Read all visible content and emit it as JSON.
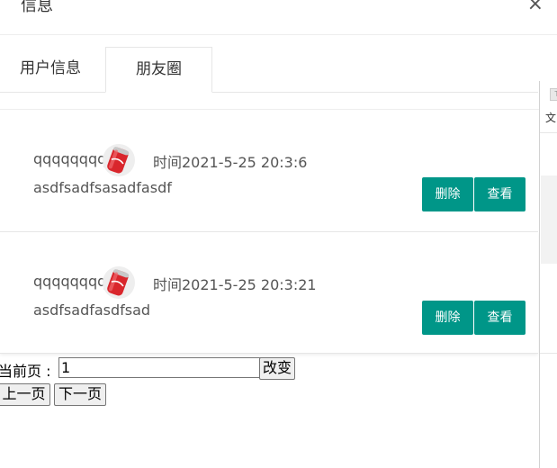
{
  "header": {
    "title": "信息",
    "close_icon": "×"
  },
  "tabs": [
    {
      "label": "用户信息"
    },
    {
      "label": "朋友圈"
    }
  ],
  "posts": [
    {
      "username": "qqqqqqqq",
      "avatar": "cola-can-avatar",
      "time": "时间2021-5-25 20:3:6",
      "content": "asdfsadfsasadfasdf",
      "delete_label": "删除",
      "view_label": "查看"
    },
    {
      "username": "qqqqqqqq",
      "avatar": "cola-can-avatar",
      "time": "时间2021-5-25 20:3:21",
      "content": "asdfsadfasdfsad",
      "delete_label": "删除",
      "view_label": "查看"
    }
  ],
  "pager": {
    "label": "当前页 :",
    "current_page": "1",
    "change_label": "改变",
    "prev_label": "上一页",
    "next_label": "下一页"
  },
  "side_panel": {
    "tab_text": "T",
    "text": "文"
  },
  "colors": {
    "accent": "#009688",
    "border": "#e6e6e6"
  }
}
